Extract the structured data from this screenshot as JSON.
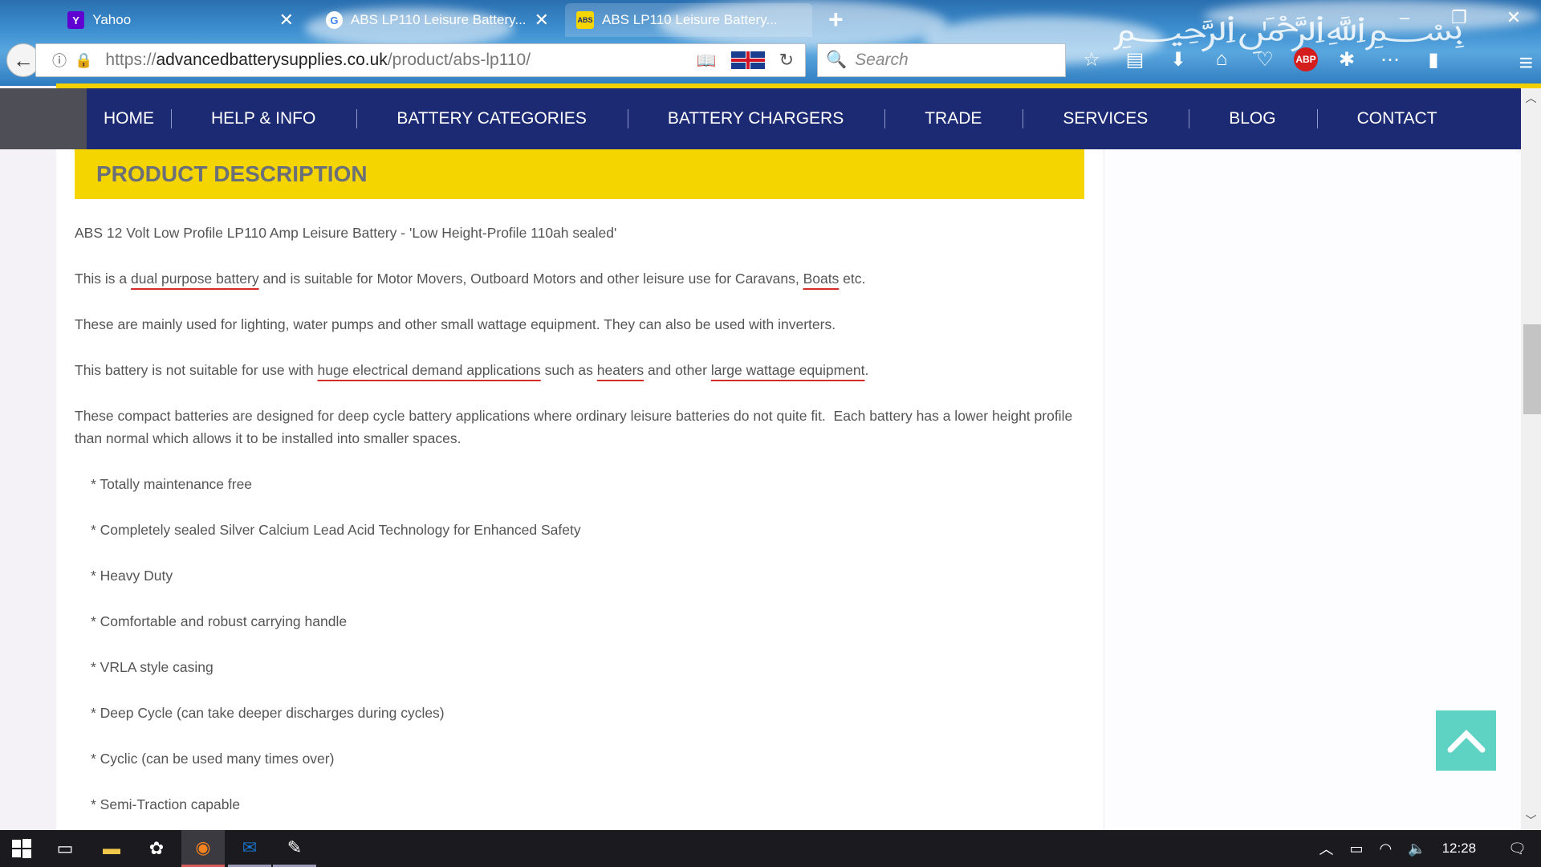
{
  "browser": {
    "tabs": [
      {
        "title": "Yahoo",
        "favicon": "Y",
        "active": false
      },
      {
        "title": "ABS LP110 Leisure Battery...",
        "favicon": "G",
        "active": false
      },
      {
        "title": "ABS LP110 Leisure Battery...",
        "favicon": "ABS",
        "active": true
      }
    ],
    "new_tab": "+",
    "url_scheme": "https://",
    "url_domain": "advancedbatterysupplies.co.uk",
    "url_path": "/product/abs-lp110/",
    "search_placeholder": "Search",
    "window_controls": [
      "–",
      "❐",
      "✕"
    ]
  },
  "site": {
    "nav_items": [
      "HOME",
      "HELP & INFO",
      "BATTERY CATEGORIES",
      "BATTERY CHARGERS",
      "TRADE",
      "SERVICES",
      "BLOG",
      "CONTACT"
    ]
  },
  "product": {
    "section_title": "PRODUCT DESCRIPTION",
    "para1": "ABS 12 Volt Low Profile LP110 Amp Leisure Battery - 'Low Height-Profile 110ah sealed'",
    "para2_a": "This is a ",
    "para2_link1": "dual purpose battery",
    "para2_b": " and is suitable for Motor Movers, Outboard Motors and other leisure use for Caravans, ",
    "para2_link2": "Boats",
    "para2_c": " etc.",
    "para3": "These are mainly used for lighting, water pumps and other small wattage equipment. They can also be used with inverters.",
    "para4_a": "This battery is not suitable for use with ",
    "para4_u1": "huge electrical demand applications",
    "para4_b": " such as ",
    "para4_u2": "heaters",
    "para4_c": " and other ",
    "para4_u3": "large wattage equipment",
    "para4_d": ".",
    "para5": "These compact batteries are designed for deep cycle battery applications where ordinary leisure batteries do not quite fit.  Each battery has a lower height profile than normal which allows it to be installed into smaller spaces.",
    "bullets": [
      "* Totally maintenance free",
      "* Completely sealed Silver Calcium Lead Acid Technology for Enhanced Safety",
      "* Heavy Duty",
      "* Comfortable and robust carrying handle",
      "* VRLA style casing",
      "* Deep Cycle (can take deeper discharges during cycles)",
      "* Cyclic (can be used many times over)",
      "* Semi-Traction capable"
    ]
  },
  "taskbar": {
    "clock": "12:28"
  },
  "colors": {
    "nav_bg": "#1c2a74",
    "accent_yellow": "#f5d500",
    "back_to_top": "#5fd3c3",
    "underline_red": "#d62b2b"
  }
}
